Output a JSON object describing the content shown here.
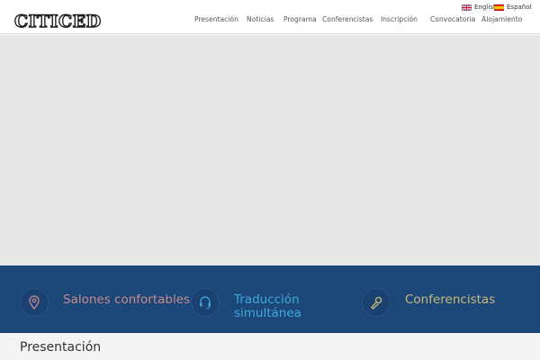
{
  "logo": {
    "text": "CITICED"
  },
  "languages": [
    {
      "label": "English",
      "flag_icon": "uk-flag-icon"
    },
    {
      "label": "Español",
      "flag_icon": "spain-flag-icon"
    }
  ],
  "nav": {
    "items": [
      {
        "label": "Presentación"
      },
      {
        "label": "Noticias"
      },
      {
        "label": "Programa"
      },
      {
        "label": "Conferencistas"
      },
      {
        "label": "Inscripción"
      },
      {
        "label": "Convocatoria"
      },
      {
        "label": "Alojamiento"
      }
    ]
  },
  "features": [
    {
      "icon": "map-pin-icon",
      "label": "Salones confortables",
      "color": "#c98a8c"
    },
    {
      "icon": "headset-icon",
      "label": "Traducción\nsimultánea",
      "color": "#3fa9de"
    },
    {
      "icon": "microphone-icon",
      "label": "Conferencistas",
      "color": "#c9b878"
    }
  ],
  "section": {
    "title": "Presentación"
  },
  "colors": {
    "header_bg": "#ffffff",
    "hero_bg": "#e8e8e8",
    "band_bg": "#1c4779",
    "section_bg": "#f4f4f4"
  }
}
